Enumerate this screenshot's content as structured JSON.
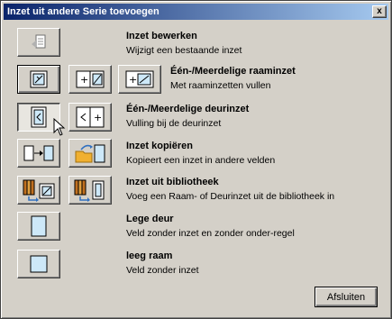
{
  "window": {
    "title": "Inzet uit andere Serie toevoegen",
    "close_glyph": "x"
  },
  "items": [
    {
      "title": "Inzet bewerken",
      "desc": "Wijzigt een bestaande inzet"
    },
    {
      "title": "Één-/Meerdelige raaminzet",
      "desc": "Met raaminzetten vullen"
    },
    {
      "title": "Één-/Meerdelige deurinzet",
      "desc": "Vulling bij de deurinzet"
    },
    {
      "title": "Inzet kopiëren",
      "desc": "Kopieert een inzet in andere velden"
    },
    {
      "title": "Inzet uit bibliotheek",
      "desc": "Voeg een Raam- of Deurinzet uit de bibliotheek in"
    },
    {
      "title": "Lege deur",
      "desc": "Veld zonder inzet en zonder onder-regel"
    },
    {
      "title": "leeg raam",
      "desc": "Veld zonder inzet"
    }
  ],
  "footer": {
    "close_label": "Afsluiten"
  },
  "colors": {
    "title_start": "#0a246a",
    "title_end": "#a6caf0",
    "face": "#d4d0c8",
    "icon_fill": "#cde8f8",
    "icon_accent": "#f0b030"
  }
}
